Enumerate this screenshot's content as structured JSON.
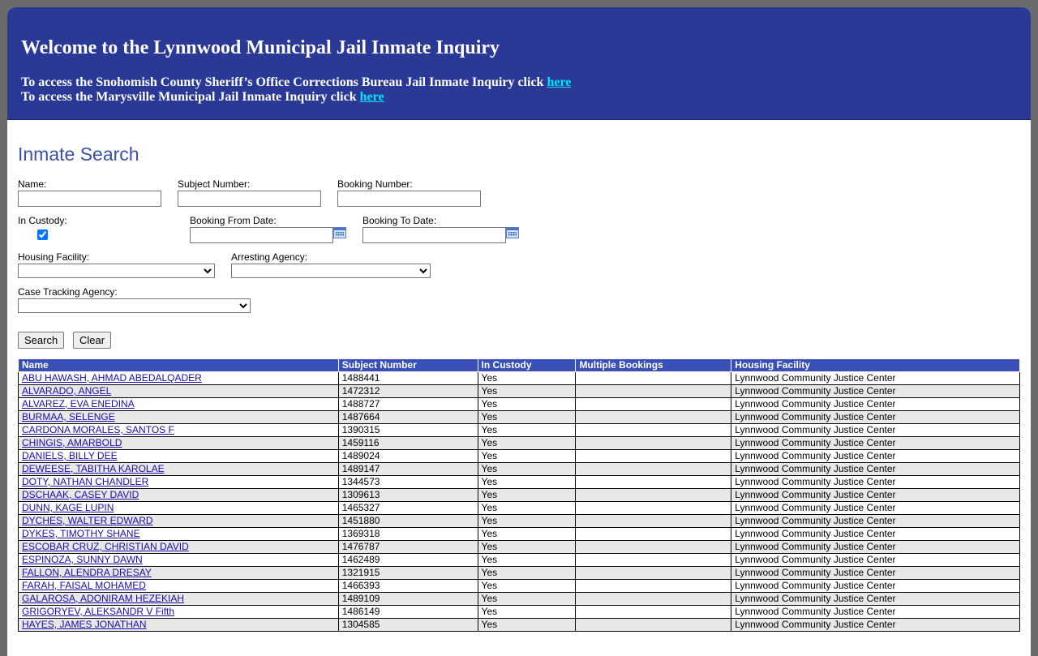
{
  "banner": {
    "title": "Welcome to the Lynnwood Municipal Jail Inmate Inquiry",
    "line1_text": "To access the Snohomish County Sheriff’s Office Corrections Bureau Jail Inmate Inquiry click ",
    "line1_link": "here",
    "line2_text": "To access the Marysville Municipal Jail Inmate Inquiry click ",
    "line2_link": "here"
  },
  "search": {
    "heading": "Inmate Search",
    "name_label": "Name:",
    "name_value": "",
    "subject_label": "Subject Number:",
    "subject_value": "",
    "booking_label": "Booking Number:",
    "booking_value": "",
    "custody_label": "In Custody:",
    "custody_checked": true,
    "from_date_label": "Booking From Date:",
    "from_date_value": "",
    "to_date_label": "Booking To Date:",
    "to_date_value": "",
    "housing_label": "Housing Facility:",
    "housing_value": "",
    "arresting_label": "Arresting Agency:",
    "arresting_value": "",
    "case_label": "Case Tracking Agency:",
    "case_value": "",
    "search_button": "Search",
    "clear_button": "Clear"
  },
  "table": {
    "columns": [
      "Name",
      "Subject Number",
      "In Custody",
      "Multiple Bookings",
      "Housing Facility"
    ],
    "rows": [
      [
        "ABU HAWASH, AHMAD ABEDALQADER",
        "1488441",
        "Yes",
        "",
        "Lynnwood Community Justice Center"
      ],
      [
        "ALVARADO, ANGEL",
        "1472312",
        "Yes",
        "",
        "Lynnwood Community Justice Center"
      ],
      [
        "ALVAREZ, EVA ENEDINA",
        "1488727",
        "Yes",
        "",
        "Lynnwood Community Justice Center"
      ],
      [
        "BURMAA, SELENGE",
        "1487664",
        "Yes",
        "",
        "Lynnwood Community Justice Center"
      ],
      [
        "CARDONA MORALES, SANTOS F",
        "1390315",
        "Yes",
        "",
        "Lynnwood Community Justice Center"
      ],
      [
        "CHINGIS, AMARBOLD",
        "1459116",
        "Yes",
        "",
        "Lynnwood Community Justice Center"
      ],
      [
        "DANIELS, BILLY DEE",
        "1489024",
        "Yes",
        "",
        "Lynnwood Community Justice Center"
      ],
      [
        "DEWEESE, TABITHA KAROLAE",
        "1489147",
        "Yes",
        "",
        "Lynnwood Community Justice Center"
      ],
      [
        "DOTY, NATHAN CHANDLER",
        "1344573",
        "Yes",
        "",
        "Lynnwood Community Justice Center"
      ],
      [
        "DSCHAAK, CASEY DAVID",
        "1309613",
        "Yes",
        "",
        "Lynnwood Community Justice Center"
      ],
      [
        "DUNN, KAGE LUPIN",
        "1465327",
        "Yes",
        "",
        "Lynnwood Community Justice Center"
      ],
      [
        "DYCHES, WALTER EDWARD",
        "1451880",
        "Yes",
        "",
        "Lynnwood Community Justice Center"
      ],
      [
        "DYKES, TIMOTHY SHANE",
        "1369318",
        "Yes",
        "",
        "Lynnwood Community Justice Center"
      ],
      [
        "ESCOBAR CRUZ, CHRISTIAN DAVID",
        "1476787",
        "Yes",
        "",
        "Lynnwood Community Justice Center"
      ],
      [
        "ESPINOZA, SUNNY DAWN",
        "1462489",
        "Yes",
        "",
        "Lynnwood Community Justice Center"
      ],
      [
        "FALLON, ALENDRA DRESAY",
        "1321915",
        "Yes",
        "",
        "Lynnwood Community Justice Center"
      ],
      [
        "FARAH, FAISAL MOHAMED",
        "1466393",
        "Yes",
        "",
        "Lynnwood Community Justice Center"
      ],
      [
        "GALAROSA, ADONIRAM HEZEKIAH",
        "1489109",
        "Yes",
        "",
        "Lynnwood Community Justice Center"
      ],
      [
        "GRIGORYEV, ALEKSANDR V Fifth",
        "1486149",
        "Yes",
        "",
        "Lynnwood Community Justice Center"
      ],
      [
        "HAYES, JAMES JONATHAN",
        "1304585",
        "Yes",
        "",
        "Lynnwood Community Justice Center"
      ]
    ]
  },
  "colors": {
    "banner_bg": "#2a3996",
    "link_cyan": "#00e5ff",
    "header_bg": "#3a4fb8",
    "heading_text": "#3a4fa8"
  }
}
